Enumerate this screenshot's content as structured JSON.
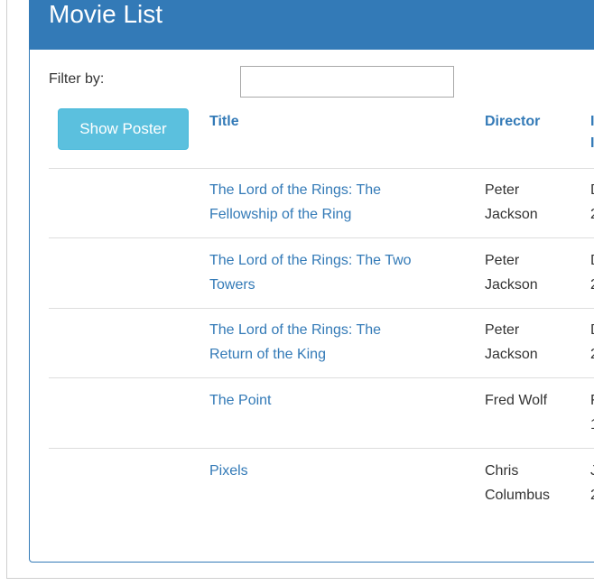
{
  "panel": {
    "title": "Movie List"
  },
  "filter": {
    "label": "Filter by:",
    "value": "",
    "placeholder": ""
  },
  "buttons": {
    "show_poster": "Show Poster"
  },
  "table": {
    "headers": {
      "title": "Title",
      "director": "Director",
      "third_line1": "I",
      "third_line2": "I"
    },
    "rows": [
      {
        "title_line1": "The Lord of the Rings: The",
        "title_line2": "Fellowship of the Ring",
        "director_line1": "Peter",
        "director_line2": "Jackson",
        "third_line1": "D",
        "third_line2": "2"
      },
      {
        "title_line1": "The Lord of the Rings: The Two",
        "title_line2": "Towers",
        "director_line1": "Peter",
        "director_line2": "Jackson",
        "third_line1": "D",
        "third_line2": "2"
      },
      {
        "title_line1": "The Lord of the Rings: The",
        "title_line2": "Return of the King",
        "director_line1": "Peter",
        "director_line2": "Jackson",
        "third_line1": "D",
        "third_line2": "2"
      },
      {
        "title_line1": "The Point",
        "title_line2": "",
        "director_line1": "Fred Wolf",
        "director_line2": "",
        "third_line1": "F",
        "third_line2": "1"
      },
      {
        "title_line1": "Pixels",
        "title_line2": "",
        "director_line1": "Chris",
        "director_line2": "Columbus",
        "third_line1": "J",
        "third_line2": "2"
      }
    ]
  }
}
